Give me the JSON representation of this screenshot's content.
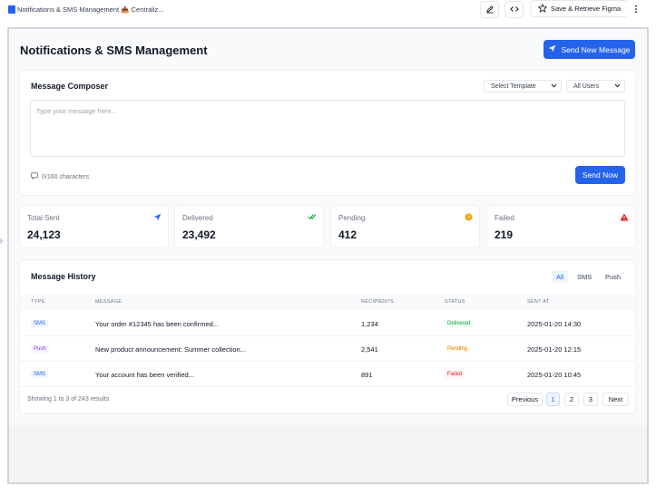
{
  "topbar": {
    "tab_title": "Notifications & SMS Management 📤 Centraliz...",
    "save_label": "Save & Retrieve Figma"
  },
  "header": {
    "title": "Notifications & SMS Management",
    "send_new_label": "Send New Message"
  },
  "composer": {
    "title": "Message Composer",
    "template_select": "Select Template",
    "users_select": "All Users",
    "placeholder": "Type your message here...",
    "char_count": "0/160 characters",
    "send_now_label": "Send Now"
  },
  "stats": [
    {
      "label": "Total Sent",
      "value": "24,123",
      "icon": "send-icon",
      "color": "#2563eb"
    },
    {
      "label": "Delivered",
      "value": "23,492",
      "icon": "double-check-icon",
      "color": "#16a34a"
    },
    {
      "label": "Pending",
      "value": "412",
      "icon": "clock-icon",
      "color": "#f59e0b"
    },
    {
      "label": "Failed",
      "value": "219",
      "icon": "warning-icon",
      "color": "#dc2626"
    }
  ],
  "history": {
    "title": "Message History",
    "filters": [
      "All",
      "SMS",
      "Push"
    ],
    "columns": [
      "TYPE",
      "MESSAGE",
      "RECIPIENTS",
      "STATUS",
      "SENT AT"
    ],
    "rows": [
      {
        "type": "SMS",
        "message": "Your order #12345 has been confirmed...",
        "recipients": "1,234",
        "status": "Delivered",
        "sent_at": "2025-01-20 14:30"
      },
      {
        "type": "Push",
        "message": "New product announcement: Summer collection...",
        "recipients": "2,541",
        "status": "Pending",
        "sent_at": "2025-01-20 12:15"
      },
      {
        "type": "SMS",
        "message": "Your account has been verified...",
        "recipients": "891",
        "status": "Failed",
        "sent_at": "2025-01-20 10:45"
      }
    ],
    "footer": "Showing 1 to 3 of 243 results",
    "pagination": {
      "previous": "Previous",
      "pages": [
        "1",
        "2",
        "3"
      ],
      "next": "Next"
    }
  },
  "colors": {
    "accent": "#2563eb",
    "sms_badge_bg": "#eff6ff",
    "push_badge_bg": "#f5f3ff",
    "delivered": "#16a34a",
    "pending": "#d97706",
    "failed": "#dc2626"
  }
}
